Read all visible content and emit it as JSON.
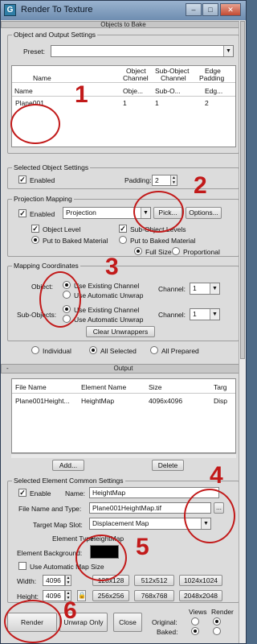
{
  "window": {
    "title": "Render To Texture",
    "app_icon": "G"
  },
  "rollouts": {
    "objects_to_bake": "Objects to Bake",
    "output": "Output",
    "output_toggle": "-"
  },
  "object_output": {
    "group_label": "Object and Output Settings",
    "preset_label": "Preset:",
    "preset_value": "",
    "table": {
      "headers": [
        {
          "line1": "",
          "line2": "Name"
        },
        {
          "line1": "Object",
          "line2": "Channel"
        },
        {
          "line1": "Sub-Object",
          "line2": "Channel"
        },
        {
          "line1": "Edge",
          "line2": "Padding"
        }
      ],
      "subrow": [
        "Name",
        "Obje...",
        "Sub-O...",
        "Edg..."
      ],
      "rows": [
        [
          "Plane001",
          "1",
          "1",
          "2"
        ]
      ]
    }
  },
  "selected_object": {
    "group_label": "Selected Object Settings",
    "enabled_label": "Enabled",
    "padding_label": "Padding:",
    "padding_value": "2"
  },
  "projection": {
    "group_label": "Projection Mapping",
    "enabled_label": "Enabled",
    "combo_value": "Projection",
    "pick_label": "Pick...",
    "options_label": "Options...",
    "object_level": "Object Level",
    "sub_object_levels": "Sub-Object Levels",
    "put_to_baked": "Put to Baked Material",
    "put_to_baked_2": "Put to Baked Material",
    "full_size": "Full Size",
    "proportional": "Proportional"
  },
  "mapping": {
    "group_label": "Mapping Coordinates",
    "object_label": "Object:",
    "sub_objects_label": "Sub-Objects:",
    "use_existing": "Use Existing Channel",
    "use_auto": "Use Automatic Unwrap",
    "channel_label": "Channel:",
    "channel_value": "1",
    "channel_value_2": "1",
    "clear_label": "Clear Unwrappers"
  },
  "bake_scope": {
    "individual": "Individual",
    "all_selected": "All Selected",
    "all_prepared": "All Prepared"
  },
  "output": {
    "headers": [
      "File Name",
      "Element Name",
      "Size",
      "Targ"
    ],
    "rows": [
      [
        "Plane001Height...",
        "HeightMap",
        "4096x4096",
        "Disp"
      ]
    ],
    "add_label": "Add...",
    "delete_label": "Delete"
  },
  "element": {
    "group_label": "Selected Element Common Settings",
    "enable_label": "Enable",
    "name_label": "Name:",
    "name_value": "HeightMap",
    "file_label": "File Name and Type:",
    "file_value": "Plane001HeightMap.tif",
    "browse_label": "...",
    "target_label": "Target Map Slot:",
    "target_value": "Displacement Map",
    "type_label": "Element Type:",
    "type_value": "HeightMap",
    "bg_label": "Element Background:",
    "bg_color": "#000000",
    "auto_size_label": "Use Automatic Map Size",
    "width_label": "Width:",
    "width_value": "4096",
    "height_label": "Height:",
    "height_value": "4096",
    "sizes": [
      "128x128",
      "512x512",
      "1024x1024",
      "256x256",
      "768x768",
      "2048x2048"
    ]
  },
  "bottom": {
    "render_label": "Render",
    "unwrap_label": "Unwrap Only",
    "close_label": "Close",
    "views_label": "Views",
    "render_col_label": "Render",
    "original_label": "Original:",
    "baked_label": "Baked:"
  },
  "annotations": {
    "color": "#c21a1a",
    "numbers": [
      "1",
      "2",
      "3",
      "4",
      "5",
      "6"
    ]
  }
}
